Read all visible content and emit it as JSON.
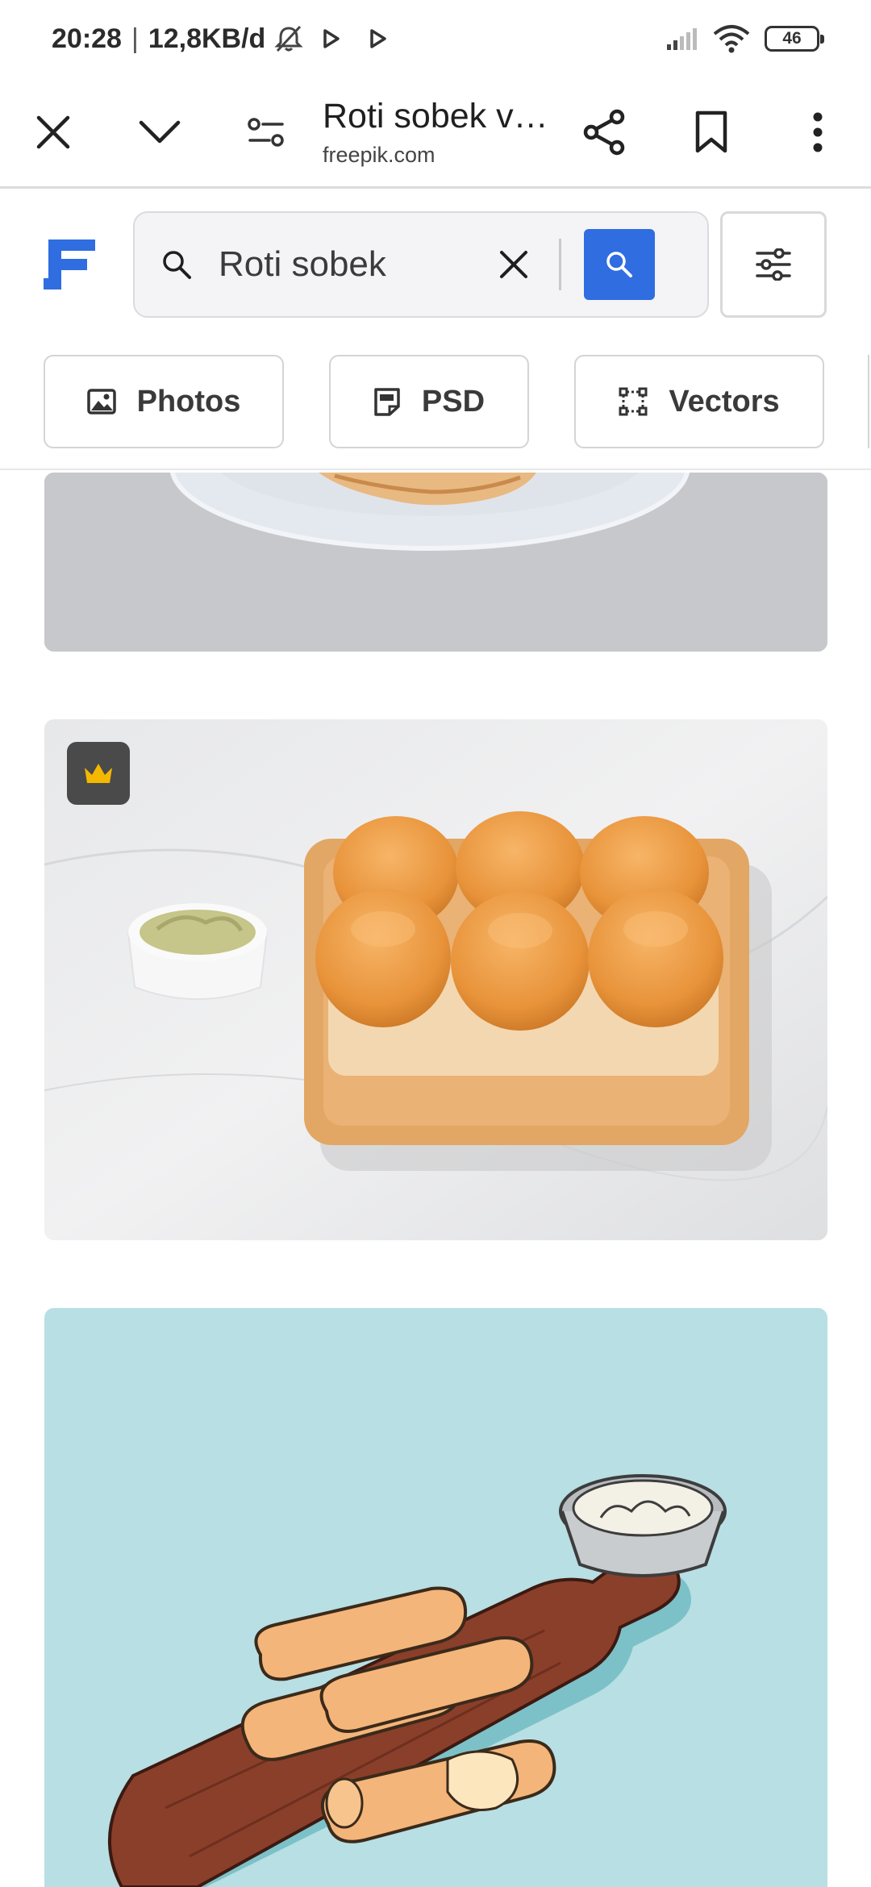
{
  "status_bar": {
    "time": "20:28",
    "separator": "|",
    "network_speed": "12,8KB/d",
    "battery": "46",
    "icons": [
      "mute-icon",
      "play-icon",
      "play-icon",
      "signal-icon",
      "wifi-icon",
      "battery-icon"
    ]
  },
  "browser": {
    "page_title": "Roti sobek ve...",
    "domain": "freepik.com",
    "icons": [
      "close-icon",
      "chevron-down-icon",
      "site-settings-icon",
      "share-icon",
      "bookmark-icon",
      "more-vert-icon"
    ]
  },
  "site": {
    "brand": "freepik",
    "search": {
      "value": "Roti sobek",
      "placeholder": ""
    },
    "chips": [
      {
        "label": "Photos",
        "icon": "image-icon"
      },
      {
        "label": "PSD",
        "icon": "psd-file-icon"
      },
      {
        "label": "Vectors",
        "icon": "vector-icon"
      }
    ]
  },
  "results": [
    {
      "kind": "photo",
      "subject": "plate on grey surface (cropped)",
      "premium": false
    },
    {
      "kind": "photo",
      "subject": "bread rolls on wooden tray with dip",
      "premium": true
    },
    {
      "kind": "vector",
      "subject": "illustrated bread sticks on cutting board with cream",
      "premium": false
    }
  ],
  "colors": {
    "accent": "#2f6de1",
    "premium_crown": "#f5b800",
    "illustration_bg": "#b8dfe3"
  }
}
